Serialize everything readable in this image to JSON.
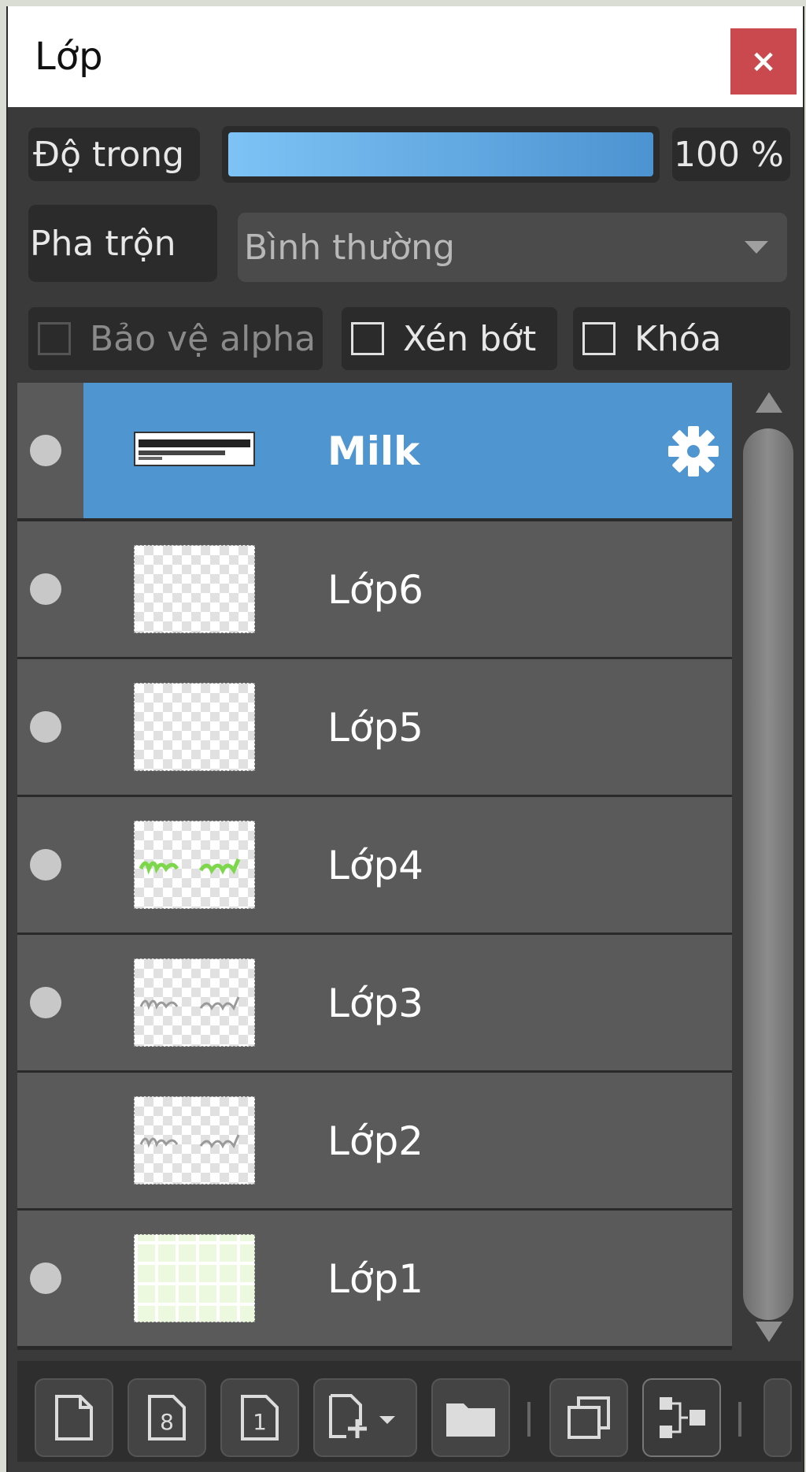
{
  "window": {
    "title": "Lớp",
    "close_label": "×"
  },
  "opacity": {
    "label": "Độ trong",
    "value_text": "100 %",
    "value": 1.0
  },
  "blend": {
    "label": "Pha trộn",
    "selected": "Bình thường"
  },
  "options": {
    "protect_alpha": {
      "label": "Bảo vệ alpha",
      "checked": false,
      "enabled": false
    },
    "clip": {
      "label": "Xén bớt",
      "checked": false,
      "enabled": true
    },
    "lock": {
      "label": "Khóa",
      "checked": false,
      "enabled": true
    }
  },
  "layers": [
    {
      "name": "Milk",
      "visible": true,
      "selected": true,
      "thumb": "text-banner",
      "settings_icon": "gear-icon"
    },
    {
      "name": "Lớp6",
      "visible": true,
      "selected": false,
      "thumb": "transparent"
    },
    {
      "name": "Lớp5",
      "visible": true,
      "selected": false,
      "thumb": "transparent"
    },
    {
      "name": "Lớp4",
      "visible": true,
      "selected": false,
      "thumb": "green-lettering"
    },
    {
      "name": "Lớp3",
      "visible": true,
      "selected": false,
      "thumb": "gray-lettering"
    },
    {
      "name": "Lớp2",
      "visible": false,
      "selected": false,
      "thumb": "gray-lettering"
    },
    {
      "name": "Lớp1",
      "visible": true,
      "selected": false,
      "thumb": "green-grid"
    }
  ],
  "toolbar": {
    "icons": [
      "new-layer-icon",
      "new-8bit-layer-icon",
      "new-1bit-layer-icon",
      "add-layer-dropdown-icon",
      "new-folder-icon",
      "duplicate-layer-icon",
      "merge-layer-icon"
    ]
  },
  "colors": {
    "selection": "#4f95d0",
    "close_button": "#c9494e",
    "panel": "#3a3a3a",
    "row": "#5a5a5a"
  }
}
